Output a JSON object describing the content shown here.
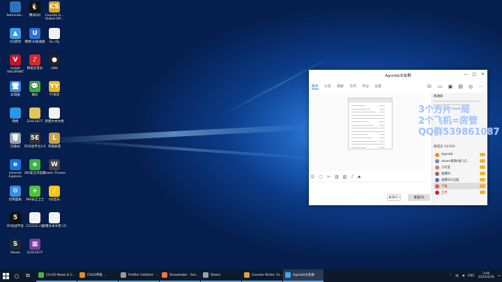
{
  "desktop": {
    "icons": [
      {
        "label": "Administr...",
        "color": "#3a6fb5",
        "glyph": "👤"
      },
      {
        "label": "腾讯QQ",
        "color": "#111111",
        "glyph": "🐧"
      },
      {
        "label": "Counter-S... Global Off...",
        "color": "#d8a422",
        "glyph": "CS"
      },
      {
        "label": "QQ游戏",
        "color": "#3a9be0",
        "glyph": "▲"
      },
      {
        "label": "网易UU加速器",
        "color": "#2f6fd8",
        "glyph": "U"
      },
      {
        "label": "bc.cfg",
        "color": "#f2f2f2",
        "glyph": ""
      },
      {
        "label": "Install VALORANT",
        "color": "#c2152b",
        "glyph": "V"
      },
      {
        "label": "网易云音乐",
        "color": "#d8282d",
        "glyph": "♪"
      },
      {
        "label": "OBS",
        "color": "#222222",
        "glyph": "●"
      },
      {
        "label": "此电脑",
        "color": "#3a8ee0",
        "glyph": "🖥"
      },
      {
        "label": "微信",
        "color": "#3cb043",
        "glyph": "💬"
      },
      {
        "label": "YY语音",
        "color": "#e5b622",
        "glyph": "YY"
      },
      {
        "label": "网络",
        "color": "#3a8ee0",
        "glyph": "🌐"
      },
      {
        "label": "22411677",
        "color": "#e7c45a",
        "glyph": ""
      },
      {
        "label": "新建文本文档",
        "color": "#f2f2f2",
        "glyph": ""
      },
      {
        "label": "回收站",
        "color": "#9aa7b5",
        "glyph": "🗑"
      },
      {
        "label": "5E对战平台3.0",
        "color": "#333333",
        "glyph": "5E"
      },
      {
        "label": "英雄联盟",
        "color": "#c9a44a",
        "glyph": "L"
      },
      {
        "label": "Internet Explorer",
        "color": "#1b74d8",
        "glyph": "e"
      },
      {
        "label": "360安全浏览器",
        "color": "#3cb043",
        "glyph": "e"
      },
      {
        "label": "Frozen Throne",
        "color": "#444444",
        "glyph": "W"
      },
      {
        "label": "控制面板",
        "color": "#3a8ee0",
        "glyph": "⚙"
      },
      {
        "label": "360安全卫士",
        "color": "#52c234",
        "glyph": "+"
      },
      {
        "label": "QQ音乐",
        "color": "#f5c518",
        "glyph": "♪"
      },
      {
        "label": "B5对战平台",
        "color": "#111111",
        "glyph": "5"
      },
      {
        "label": "121212.cfg",
        "color": "#f2f2f2",
        "glyph": ""
      },
      {
        "label": "新建文本文档 (2)",
        "color": "#f2f2f2",
        "glyph": ""
      },
      {
        "label": "Steam",
        "color": "#1b2838",
        "glyph": "S"
      },
      {
        "label": "22411677",
        "color": "#7b3fa0",
        "glyph": "▦"
      }
    ]
  },
  "qq_window": {
    "title": "Agonbb水友群",
    "tabs": [
      "聊天",
      "公告",
      "相册",
      "文件",
      "作业",
      "设置"
    ],
    "notice_title": "群通知",
    "member_header": "群成员 54/264",
    "members": [
      "Agonbb",
      "steam邀请A级 [尤…",
      "工作室",
      "威爆利",
      "威爆SS1旦超",
      "下载",
      "互伴"
    ],
    "member_colors": [
      "#f08a24",
      "#6a8fbf",
      "#e57373",
      "#8d6e63",
      "#5c6bc0",
      "#ef5350",
      "#c62828"
    ],
    "close_label": "关闭(C)",
    "send_label": "发送(S)"
  },
  "overlay": {
    "line1": "3个方片一局",
    "line2": "2个飞机=房管",
    "line3": "QQ群539861087"
  },
  "taskbar": {
    "apps": [
      {
        "label": "CS:GO News & C...",
        "color": "#4caf50"
      },
      {
        "label": "CSGO审批 ...",
        "color": "#e08b2c"
      },
      {
        "label": "Profiler Untitled - ...",
        "color": "#999999"
      },
      {
        "label": "Streamlabs - Sat...",
        "color": "#ff7043"
      },
      {
        "label": "Steam",
        "color": "#90a4ae"
      },
      {
        "label": "Counter-Strike: Gl...",
        "color": "#e0a030"
      },
      {
        "label": "Agonbb水友群",
        "color": "#42a5f5"
      }
    ],
    "tray_lang": "ENG",
    "time": "3:06",
    "date": "2020/4/28"
  }
}
